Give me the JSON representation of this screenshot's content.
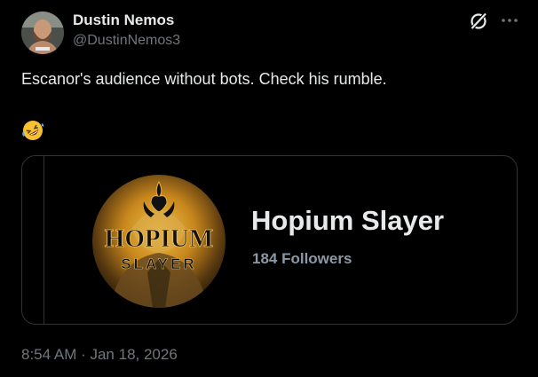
{
  "author": {
    "name": "Dustin Nemos",
    "handle": "@DustinNemos3"
  },
  "post": {
    "text": "Escanor's audience without bots. Check his rumble.",
    "emoji_icon": "rolling-on-floor-laughing-emoji"
  },
  "card": {
    "logo_text_top": "HOPIUM",
    "logo_text_bottom": "SLAYER",
    "title": "Hopium Slayer",
    "followers": "184 Followers"
  },
  "footer": {
    "timestamp": "8:54 AM · Jan 18, 2026"
  },
  "icons": {
    "header_actions": [
      "grok-icon",
      "more-icon"
    ]
  },
  "colors": {
    "background": "#000000",
    "primary_text": "#e7e9ea",
    "secondary_text": "#71767b",
    "border": "#2f3336"
  }
}
